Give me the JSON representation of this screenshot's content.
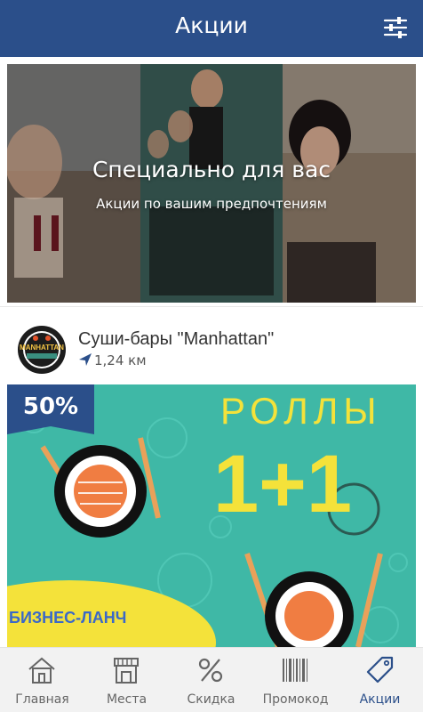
{
  "header": {
    "title": "Акции",
    "filter_icon": "sliders-icon"
  },
  "hero": {
    "title": "Специально для вас",
    "subtitle": "Акции по вашим предпочтениям"
  },
  "place": {
    "name": "Суши-бары \"Manhattan\"",
    "distance": "1,24 км",
    "logo_text": "MANHATTAN"
  },
  "promo": {
    "discount_badge": "50%",
    "heading": "РОЛЛЫ",
    "offer": "1+1",
    "lunch": "БИЗНЕС-ЛАНЧ",
    "colors": {
      "background": "#3fb8a6",
      "accent": "#f4e23a",
      "badge": "#2b4f8a"
    }
  },
  "tabs": [
    {
      "label": "Главная",
      "icon": "home-icon"
    },
    {
      "label": "Места",
      "icon": "store-icon"
    },
    {
      "label": "Скидка",
      "icon": "percent-icon"
    },
    {
      "label": "Промокод",
      "icon": "barcode-icon"
    },
    {
      "label": "Акции",
      "icon": "tag-icon",
      "active": true
    }
  ],
  "colors": {
    "primary": "#2b4f8a",
    "tab_inactive": "#666666"
  }
}
